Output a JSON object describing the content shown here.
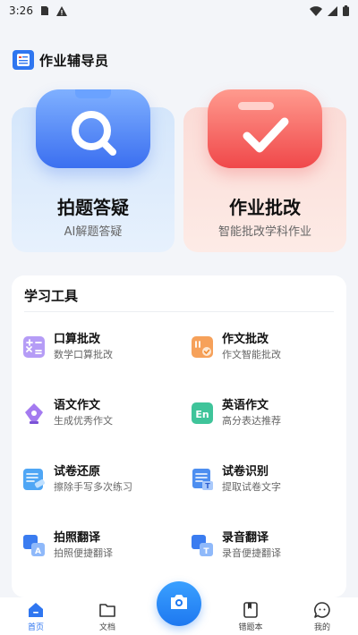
{
  "status_bar": {
    "time": "3:26",
    "icons": [
      "sim-icon",
      "warning-icon",
      "wifi-icon",
      "signal-icon",
      "battery-icon"
    ]
  },
  "header": {
    "title": "作业辅导员",
    "logo_icon": "notebook-icon"
  },
  "cards": [
    {
      "title": "拍题答疑",
      "subtitle": "AI解题答疑",
      "icon": "magnifier-icon",
      "color": "#3b6ff0"
    },
    {
      "title": "作业批改",
      "subtitle": "智能批改学科作业",
      "icon": "checkmark-icon",
      "color": "#f0484a"
    }
  ],
  "tools": {
    "title": "学习工具",
    "items": [
      {
        "name": "口算批改",
        "desc": "数学口算批改",
        "icon": "math-calc-icon"
      },
      {
        "name": "作文批改",
        "desc": "作文智能批改",
        "icon": "essay-correct-icon"
      },
      {
        "name": "语文作文",
        "desc": "生成优秀作文",
        "icon": "pen-nib-icon"
      },
      {
        "name": "英语作文",
        "desc": "高分表达推荐",
        "icon": "english-en-icon"
      },
      {
        "name": "试卷还原",
        "desc": "擦除手写多次练习",
        "icon": "paper-restore-icon"
      },
      {
        "name": "试卷识别",
        "desc": "提取试卷文字",
        "icon": "paper-scan-icon"
      },
      {
        "name": "拍照翻译",
        "desc": "拍照便捷翻译",
        "icon": "photo-translate-icon"
      },
      {
        "name": "录音翻译",
        "desc": "录音便捷翻译",
        "icon": "audio-translate-icon"
      }
    ]
  },
  "bottom_nav": {
    "items": [
      {
        "label": "首页",
        "icon": "home-icon",
        "active": true
      },
      {
        "label": "文档",
        "icon": "folder-icon",
        "active": false
      },
      {
        "label": "错题本",
        "icon": "notebook-icon",
        "active": false
      },
      {
        "label": "我的",
        "icon": "chat-profile-icon",
        "active": false
      }
    ],
    "camera_icon": "camera-icon"
  },
  "colors": {
    "accent": "#2f76f0",
    "background": "#f3f5f9"
  }
}
